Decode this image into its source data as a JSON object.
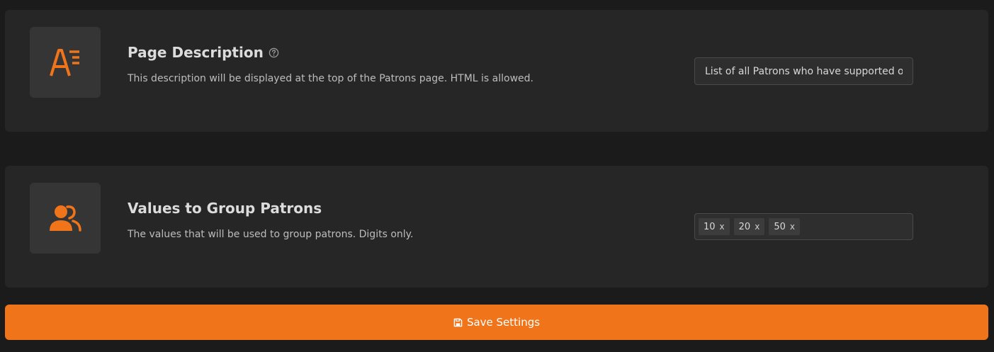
{
  "accent_color": "#ef741a",
  "settings": [
    {
      "icon": "text-format-icon",
      "title": "Page Description",
      "help_icon": "question-circle-icon",
      "description": "This description will be displayed at the top of the Patrons page. HTML is allowed.",
      "input_value": "List of all Patrons who have supported our work"
    },
    {
      "icon": "users-icon",
      "title": "Values to Group Patrons",
      "description": "The values that will be used to group patrons. Digits only.",
      "tags": [
        {
          "label": "10",
          "remove": "x"
        },
        {
          "label": "20",
          "remove": "x"
        },
        {
          "label": "50",
          "remove": "x"
        }
      ]
    }
  ],
  "save_button": {
    "icon": "floppy-disk-icon",
    "label": "Save Settings"
  }
}
